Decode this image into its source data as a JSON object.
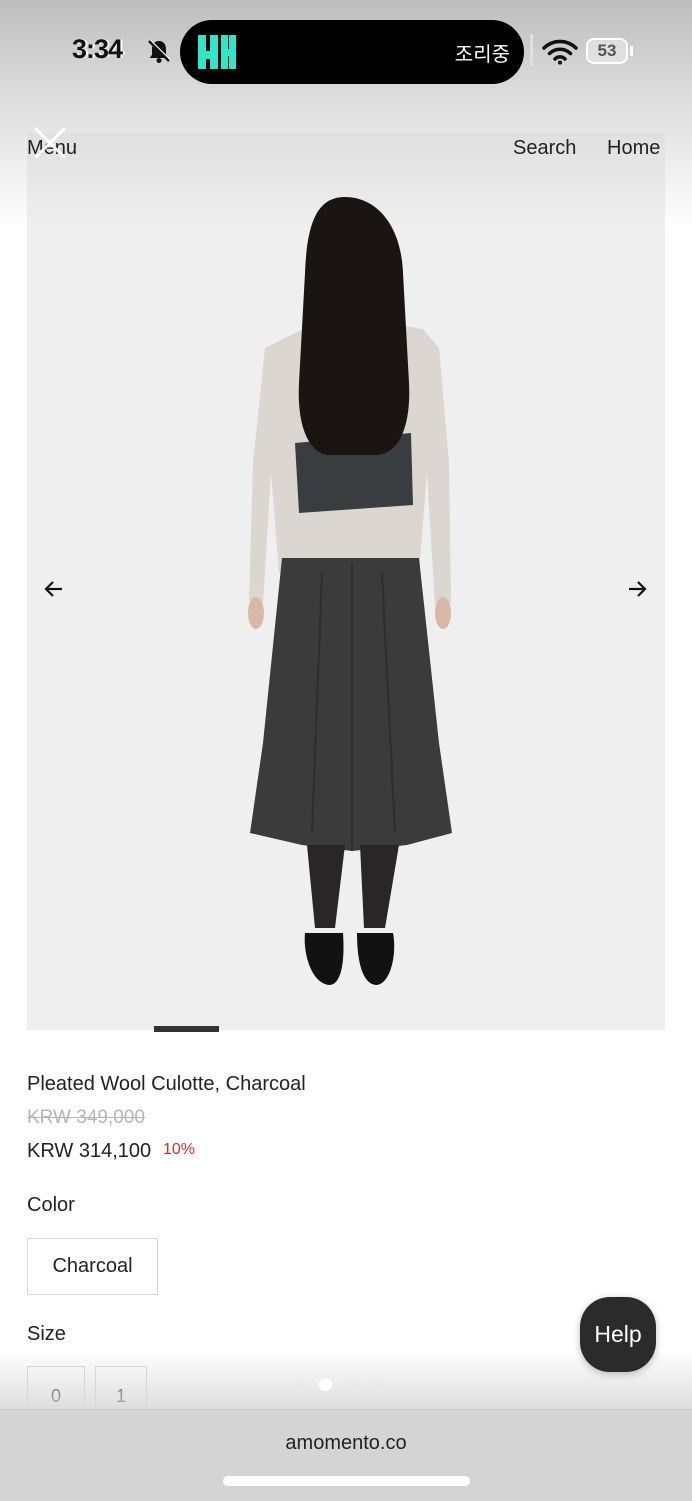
{
  "status_bar": {
    "time": "3:34",
    "island_text": "조리중",
    "battery_level": "53"
  },
  "header": {
    "menu_label": "Menu",
    "search_label": "Search",
    "home_label": "Home"
  },
  "product": {
    "name": "Pleated Wool Culotte, Charcoal",
    "price_original": "KRW 349,000",
    "price_sale": "KRW 314,100",
    "discount": "10%",
    "color_label": "Color",
    "color_options": [
      "Charcoal"
    ],
    "size_label": "Size",
    "size_options": [
      "0",
      "1"
    ]
  },
  "help_button": {
    "label": "Help"
  },
  "browser": {
    "url": "amomento.co"
  },
  "colors": {
    "discount": "#d0312d",
    "help_bg": "#2b2b2b",
    "island_logo": "#2ee6c8"
  },
  "icons": [
    "bell-slash-icon",
    "wifi-icon",
    "battery-icon",
    "close-icon",
    "arrow-left-icon",
    "arrow-right-icon"
  ]
}
